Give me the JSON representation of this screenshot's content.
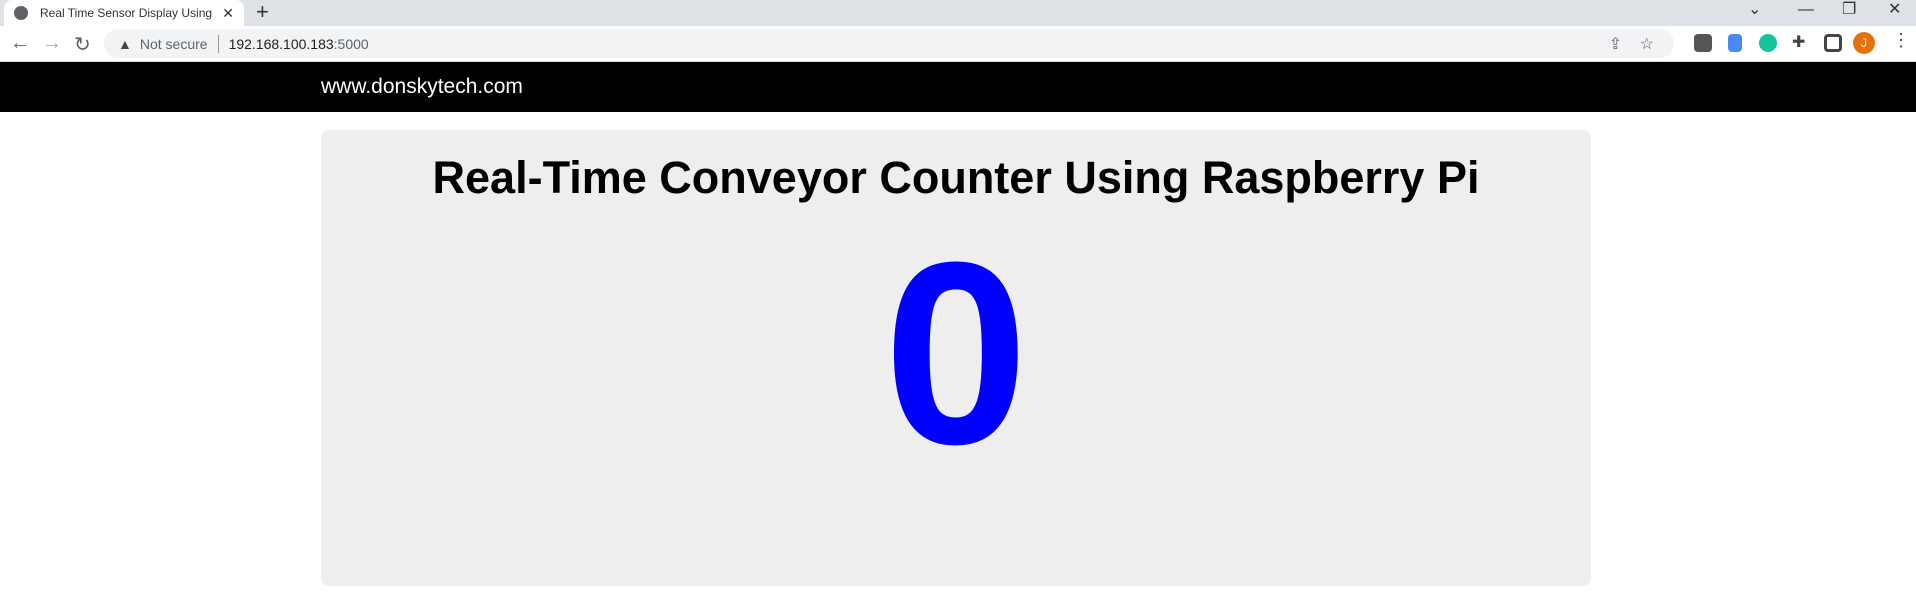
{
  "browser": {
    "tab_title": "Real Time Sensor Display Using Raspberry Pi",
    "security_label": "Not secure",
    "url_host": "192.168.100.183",
    "url_port": ":5000",
    "profile_initial": "J"
  },
  "header": {
    "brand": "www.donskytech.com"
  },
  "main": {
    "title": "Real-Time Conveyor Counter Using Raspberry Pi",
    "count": "0",
    "count_color": "#0000ff"
  }
}
